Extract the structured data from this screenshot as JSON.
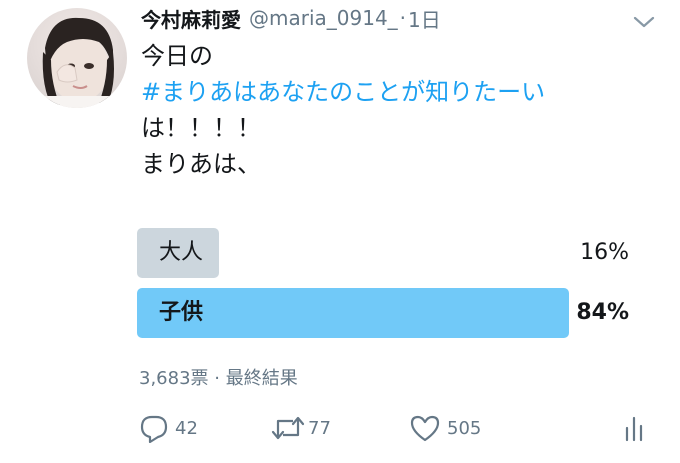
{
  "tweet": {
    "display_name": "今村麻莉愛",
    "handle": "@maria_0914_",
    "separator": "·",
    "time": "1日",
    "text_lines": [
      "今日の",
      "#まりあはあなたのことが知りたーい",
      "は！！！！",
      "まりあは、"
    ]
  },
  "poll": {
    "options": [
      {
        "label": "大人",
        "percent_text": "16%",
        "percent": 16,
        "winner": false
      },
      {
        "label": "子供",
        "percent_text": "84%",
        "percent": 84,
        "winner": true
      }
    ],
    "meta": "3,683票 · 最終結果",
    "colors": {
      "winner_bar": "#71c9f8",
      "other_bar": "#ccd6dd"
    }
  },
  "actions": {
    "reply": {
      "icon": "reply-icon",
      "count": "42"
    },
    "retweet": {
      "icon": "retweet-icon",
      "count": "77"
    },
    "like": {
      "icon": "heart-icon",
      "count": "505"
    },
    "analytics": {
      "icon": "analytics-icon"
    }
  }
}
